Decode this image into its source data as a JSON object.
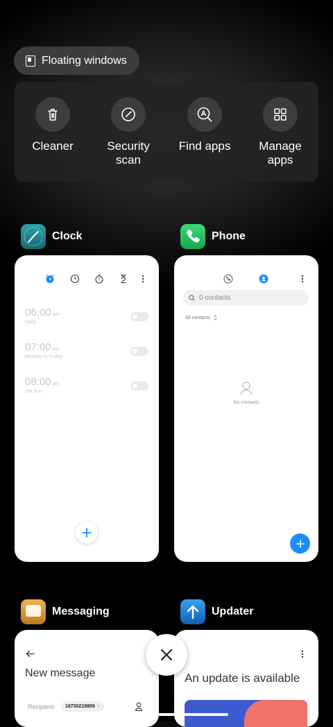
{
  "floating_windows": {
    "label": "Floating windows",
    "icon": "floating-window-icon"
  },
  "tools": [
    {
      "label": "Cleaner",
      "icon": "trash-icon"
    },
    {
      "label": "Security\nscan",
      "icon": "security-scan-icon"
    },
    {
      "label": "Find apps",
      "icon": "find-apps-icon"
    },
    {
      "label": "Manage\napps",
      "icon": "grid-icon"
    }
  ],
  "apps": {
    "clock": {
      "name": "Clock",
      "alarms": [
        {
          "time": "06:00",
          "ampm": "am",
          "repeat": "Daily"
        },
        {
          "time": "07:00",
          "ampm": "am",
          "repeat": "Monday to Friday"
        },
        {
          "time": "08:00",
          "ampm": "am",
          "repeat": "Sat Sun"
        }
      ]
    },
    "phone": {
      "name": "Phone",
      "search_placeholder": "0 contacts",
      "filter": "All contacts",
      "empty_text": "No contacts"
    },
    "messaging": {
      "name": "Messaging",
      "title": "New message",
      "recipient_label": "Recipient:",
      "recipient_value": "18730218809"
    },
    "updater": {
      "name": "Updater",
      "title": "An update is available"
    }
  },
  "colors": {
    "accent": "#1a8cff",
    "phone_green": "#1fbf5a",
    "clock_teal": "#1d8a8f",
    "updater_blue": "#1b7fd6"
  }
}
